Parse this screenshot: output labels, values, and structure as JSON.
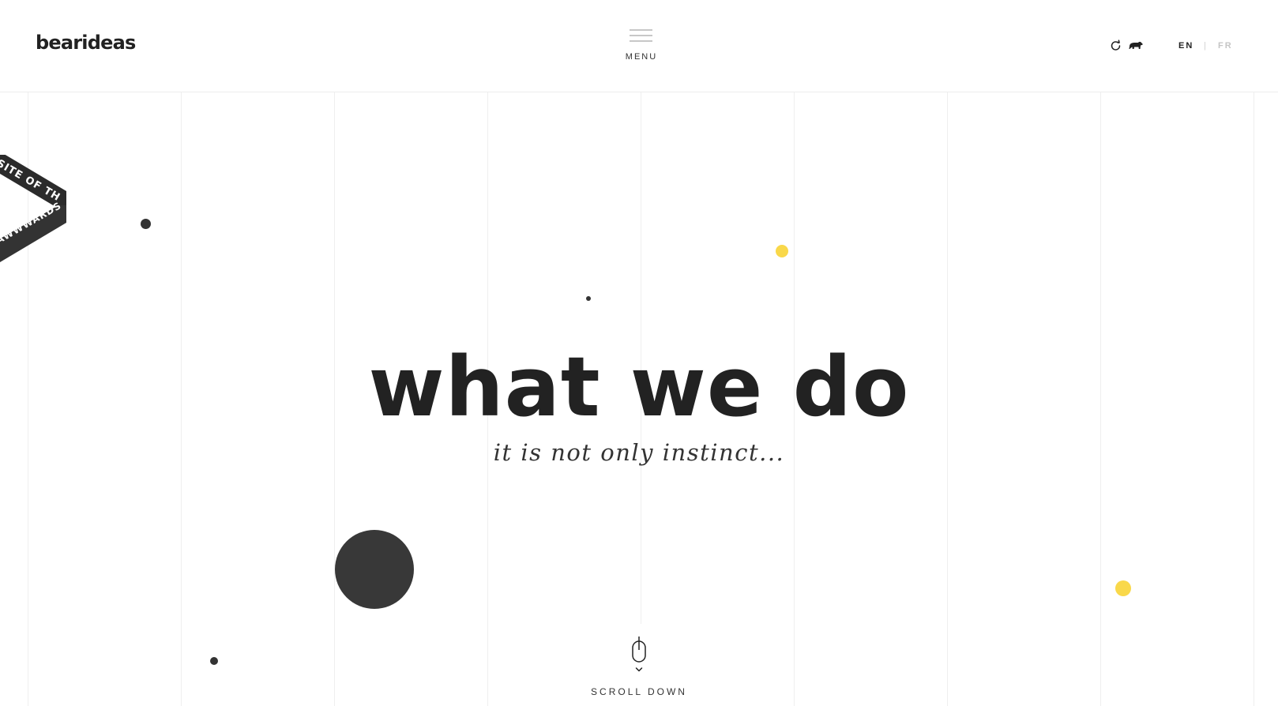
{
  "header": {
    "logo": "bearideas",
    "menu_label": "MENU",
    "sound_icon": "sound-toggle-icon",
    "bear_icon": "bear-icon",
    "languages": {
      "en": "EN",
      "separator": "|",
      "fr": "FR",
      "active": "EN"
    }
  },
  "badge": {
    "top_text": "SITE OF THE DAY",
    "bottom_text": "AWWWARDS"
  },
  "hero": {
    "title": "what we do",
    "subtitle": "it is not only instinct..."
  },
  "scroll": {
    "label": "SCROLL DOWN",
    "icon": "mouse-icon"
  },
  "colors": {
    "text_dark": "#222222",
    "accent_yellow": "#f9d84a",
    "dot_dark": "#333333",
    "grid_line": "#efefef",
    "lang_inactive": "#c5c5c5"
  }
}
